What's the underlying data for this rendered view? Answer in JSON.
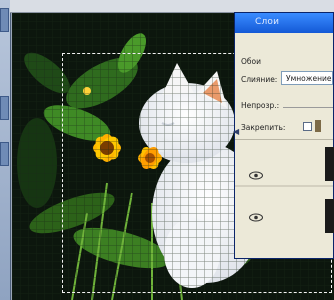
{
  "layers_panel": {
    "title": "Слои",
    "subtitle": "Обои",
    "blend_label": "Слияние:",
    "blend_value": "Умножение",
    "opacity_label": "Непрозр.:",
    "lock_label": "Закрепить:"
  },
  "icons": {
    "visibility": "eye-icon",
    "lock_transparency": "lock-transparency-icon",
    "lock_image": "lock-image-icon"
  }
}
